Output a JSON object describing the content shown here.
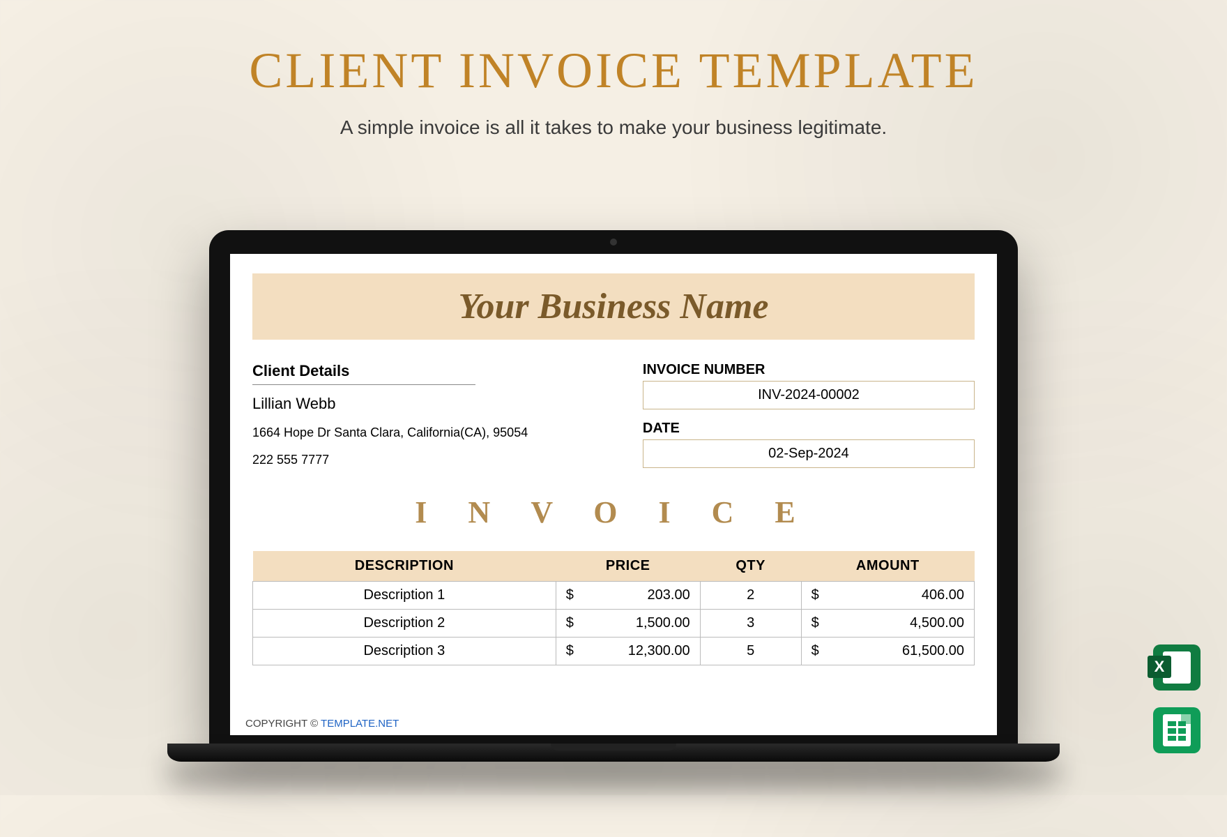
{
  "header": {
    "title": "CLIENT INVOICE TEMPLATE",
    "subtitle": "A simple invoice is all it takes to make your business legitimate."
  },
  "invoice": {
    "business_name": "Your Business Name",
    "client_heading": "Client Details",
    "client_name": "Lillian Webb",
    "client_address": "1664 Hope Dr Santa Clara, California(CA), 95054",
    "client_phone": "222 555 7777",
    "invoice_number_label": "INVOICE NUMBER",
    "invoice_number": "INV-2024-00002",
    "date_label": "DATE",
    "date": "02-Sep-2024",
    "invoice_word": "I N V O I C E",
    "columns": {
      "description": "DESCRIPTION",
      "price": "PRICE",
      "qty": "QTY",
      "amount": "AMOUNT"
    },
    "currency": "$",
    "items": [
      {
        "description": "Description 1",
        "price": "203.00",
        "qty": "2",
        "amount": "406.00"
      },
      {
        "description": "Description 2",
        "price": "1,500.00",
        "qty": "3",
        "amount": "4,500.00"
      },
      {
        "description": "Description 3",
        "price": "12,300.00",
        "qty": "5",
        "amount": "61,500.00"
      }
    ]
  },
  "footer": {
    "copyright_prefix": "COPYRIGHT © ",
    "brand": "TEMPLATE.NET"
  },
  "icons": {
    "excel": "X"
  }
}
